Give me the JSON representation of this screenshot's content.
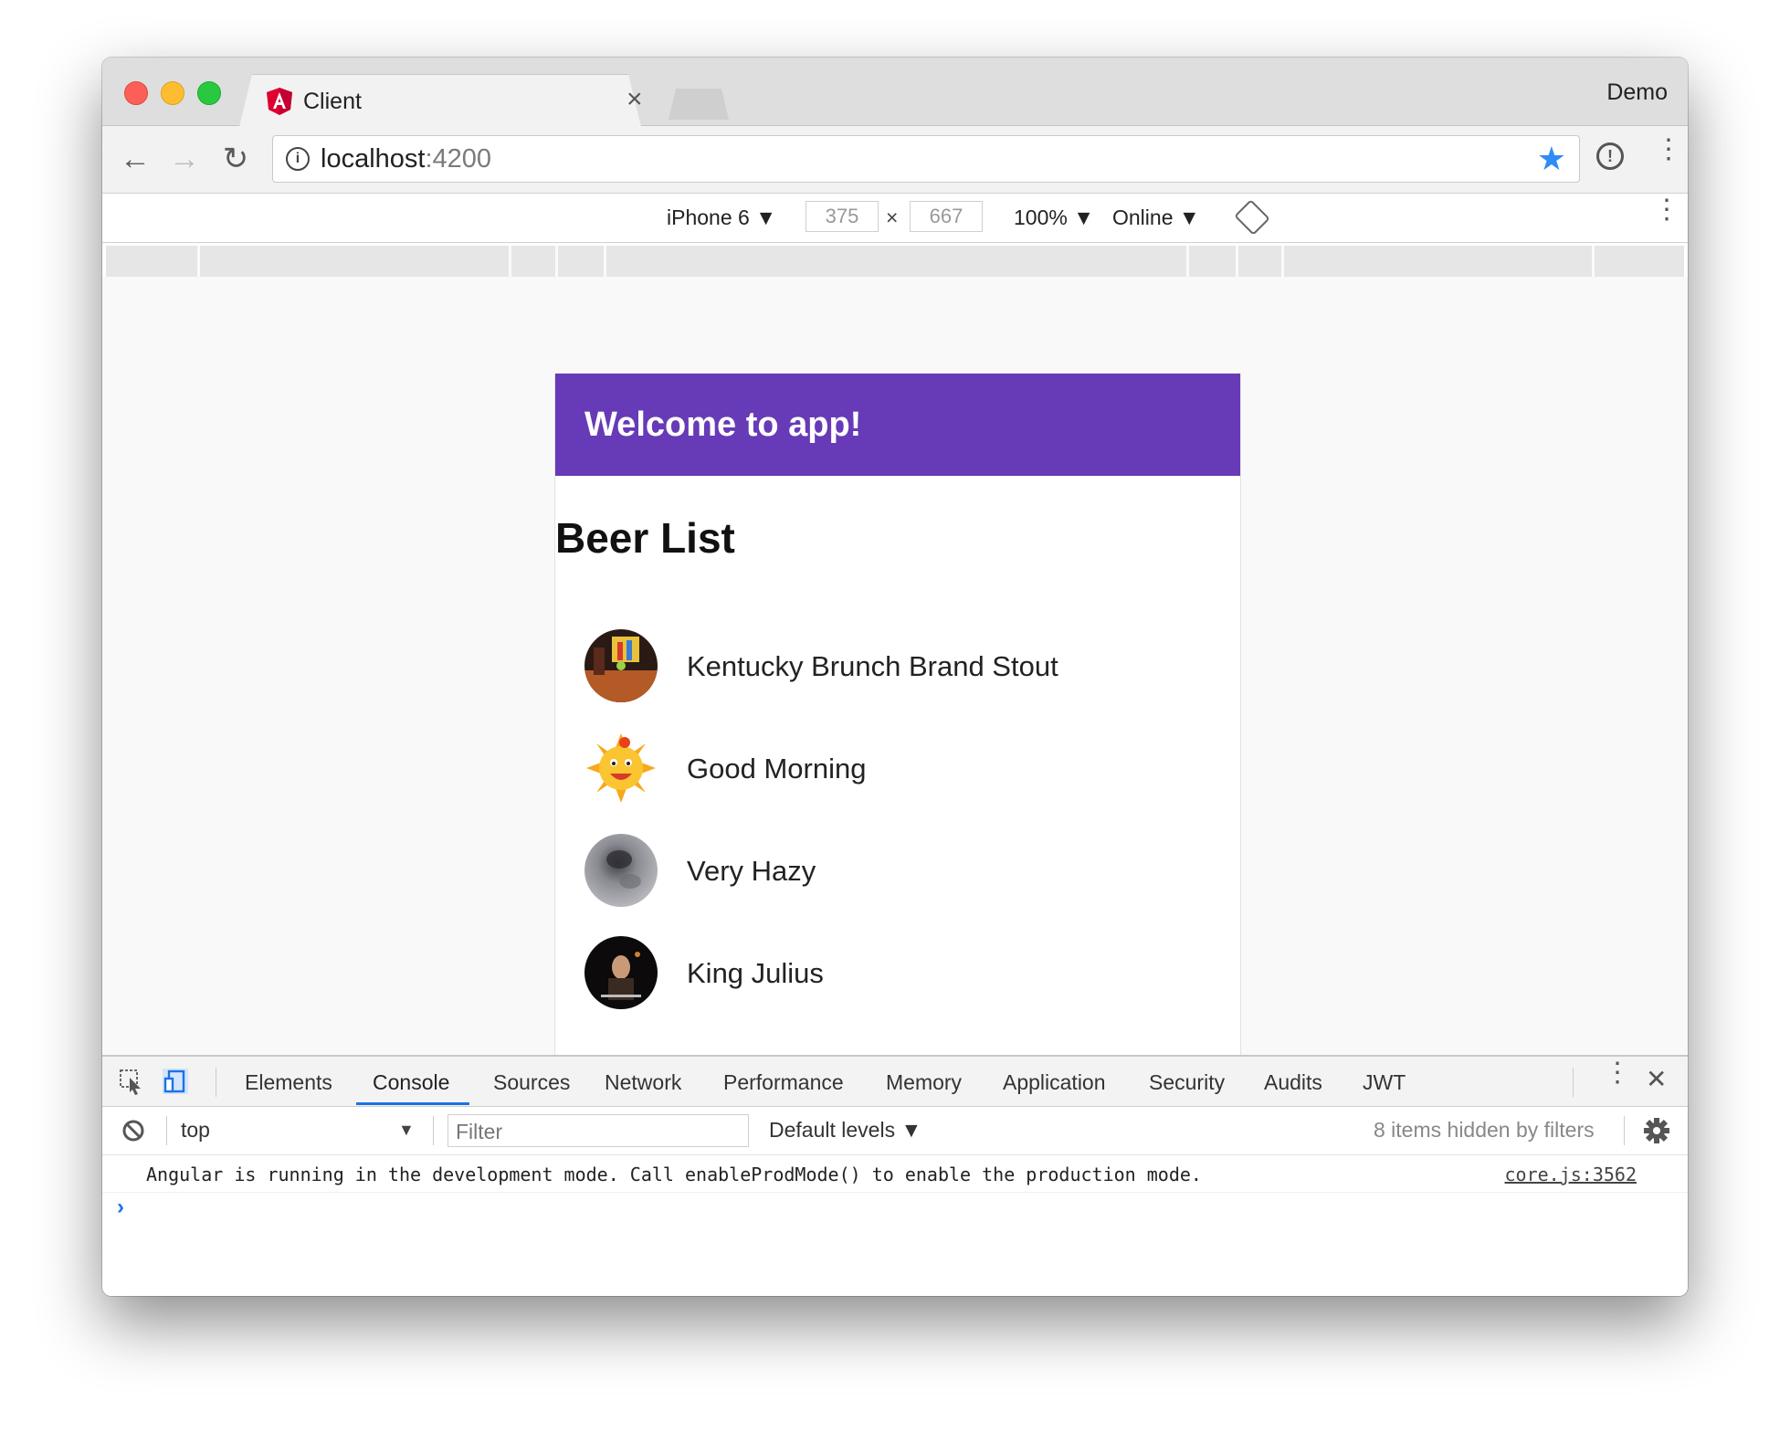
{
  "browser": {
    "tab_title": "Client",
    "tab_close": "×",
    "profile_name": "Demo",
    "url_host": "localhost",
    "url_port": ":4200",
    "back": "←",
    "forward": "→",
    "reload": "↻",
    "star": "★",
    "menu": "⋮"
  },
  "device_toolbar": {
    "device": "iPhone 6 ▼",
    "width": "375",
    "times": "×",
    "height": "667",
    "zoom": "100% ▼",
    "network": "Online ▼",
    "menu": "⋮"
  },
  "app": {
    "header_title": "Welcome to app!",
    "header_color": "#673ab7",
    "list_heading": "Beer List",
    "beers": [
      {
        "name": "Kentucky Brunch Brand Stout"
      },
      {
        "name": "Good Morning"
      },
      {
        "name": "Very Hazy"
      },
      {
        "name": "King Julius"
      }
    ]
  },
  "devtools": {
    "tabs": [
      "Elements",
      "Console",
      "Sources",
      "Network",
      "Performance",
      "Memory",
      "Application",
      "Security",
      "Audits",
      "JWT"
    ],
    "active_tab": "Console",
    "context": "top",
    "context_arrow": "▼",
    "filter_placeholder": "Filter",
    "levels": "Default levels ▼",
    "hidden_note": "8 items hidden by filters",
    "close": "✕",
    "menu": "⋮",
    "console_message": "Angular is running in the development mode. Call enableProdMode() to enable the production mode.",
    "console_source": "core.js:3562",
    "prompt": "›"
  }
}
